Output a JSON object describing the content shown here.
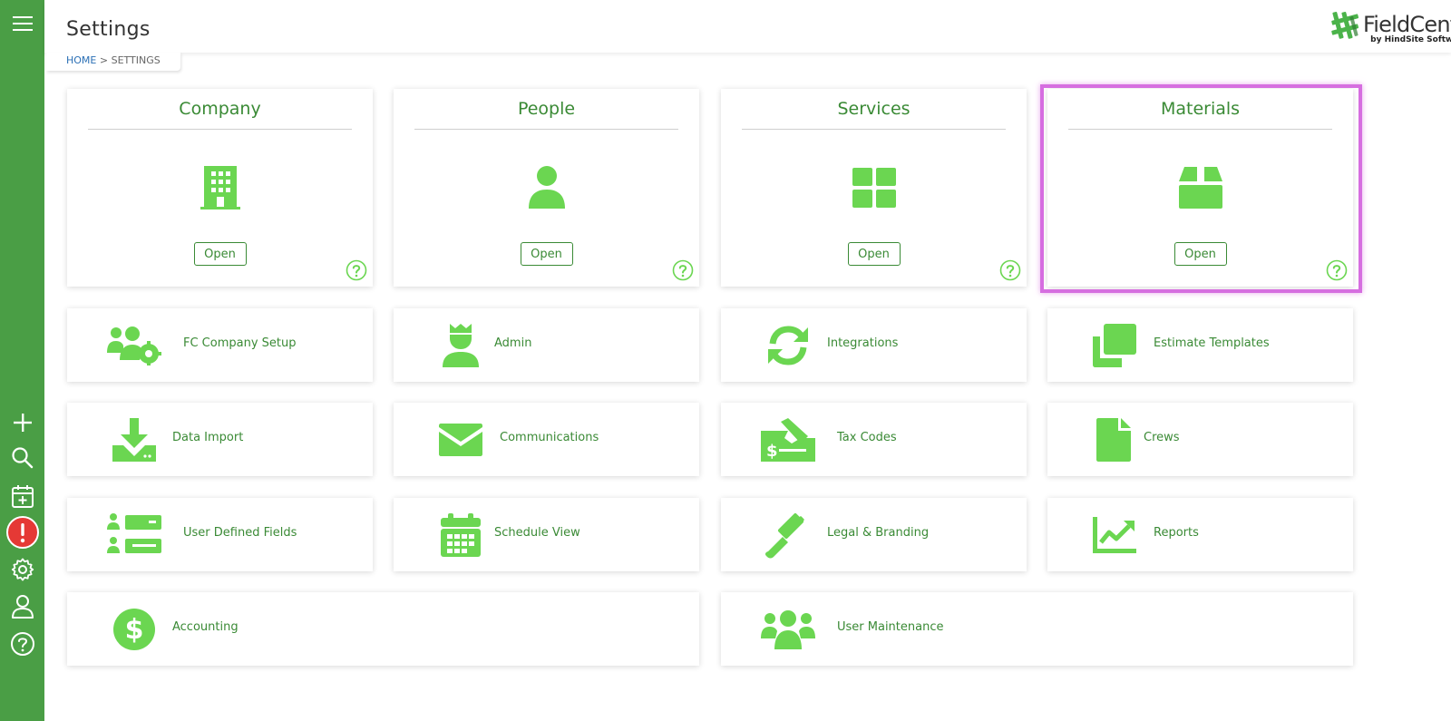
{
  "header": {
    "title": "Settings"
  },
  "breadcrumb": {
    "home": "HOME",
    "separator": ">",
    "current": "SETTINGS"
  },
  "logo": {
    "name": "FieldCentral",
    "sub": "by HindSite Software"
  },
  "cards": [
    {
      "title": "Company",
      "open": "Open",
      "icon": "building-icon"
    },
    {
      "title": "People",
      "open": "Open",
      "icon": "person-icon"
    },
    {
      "title": "Services",
      "open": "Open",
      "icon": "grid-icon"
    },
    {
      "title": "Materials",
      "open": "Open",
      "icon": "box-icon",
      "highlighted": true
    }
  ],
  "tiles": [
    {
      "label": "FC Company Setup",
      "icon": "users-gear-icon"
    },
    {
      "label": "Admin",
      "icon": "admin-crown-icon"
    },
    {
      "label": "Integrations",
      "icon": "sync-icon"
    },
    {
      "label": "Estimate Templates",
      "icon": "copy-icon"
    },
    {
      "label": "Data Import",
      "icon": "download-icon"
    },
    {
      "label": "Communications",
      "icon": "envelope-icon"
    },
    {
      "label": "Tax Codes",
      "icon": "money-check-pen-icon"
    },
    {
      "label": "Crews",
      "icon": "file-icon"
    },
    {
      "label": "User Defined Fields",
      "icon": "user-fields-icon"
    },
    {
      "label": "Schedule View",
      "icon": "calendar-icon"
    },
    {
      "label": "Legal & Branding",
      "icon": "gavel-icon"
    },
    {
      "label": "Reports",
      "icon": "chart-line-icon"
    },
    {
      "label": "Accounting",
      "icon": "dollar-circle-icon"
    },
    {
      "label": "User Maintenance",
      "icon": "users-icon"
    }
  ],
  "colors": {
    "sidebar": "#4a9e45",
    "accent": "#3a8a35",
    "icon": "#6bd651",
    "highlight": "#d66ee0",
    "alert": "#e53935"
  }
}
